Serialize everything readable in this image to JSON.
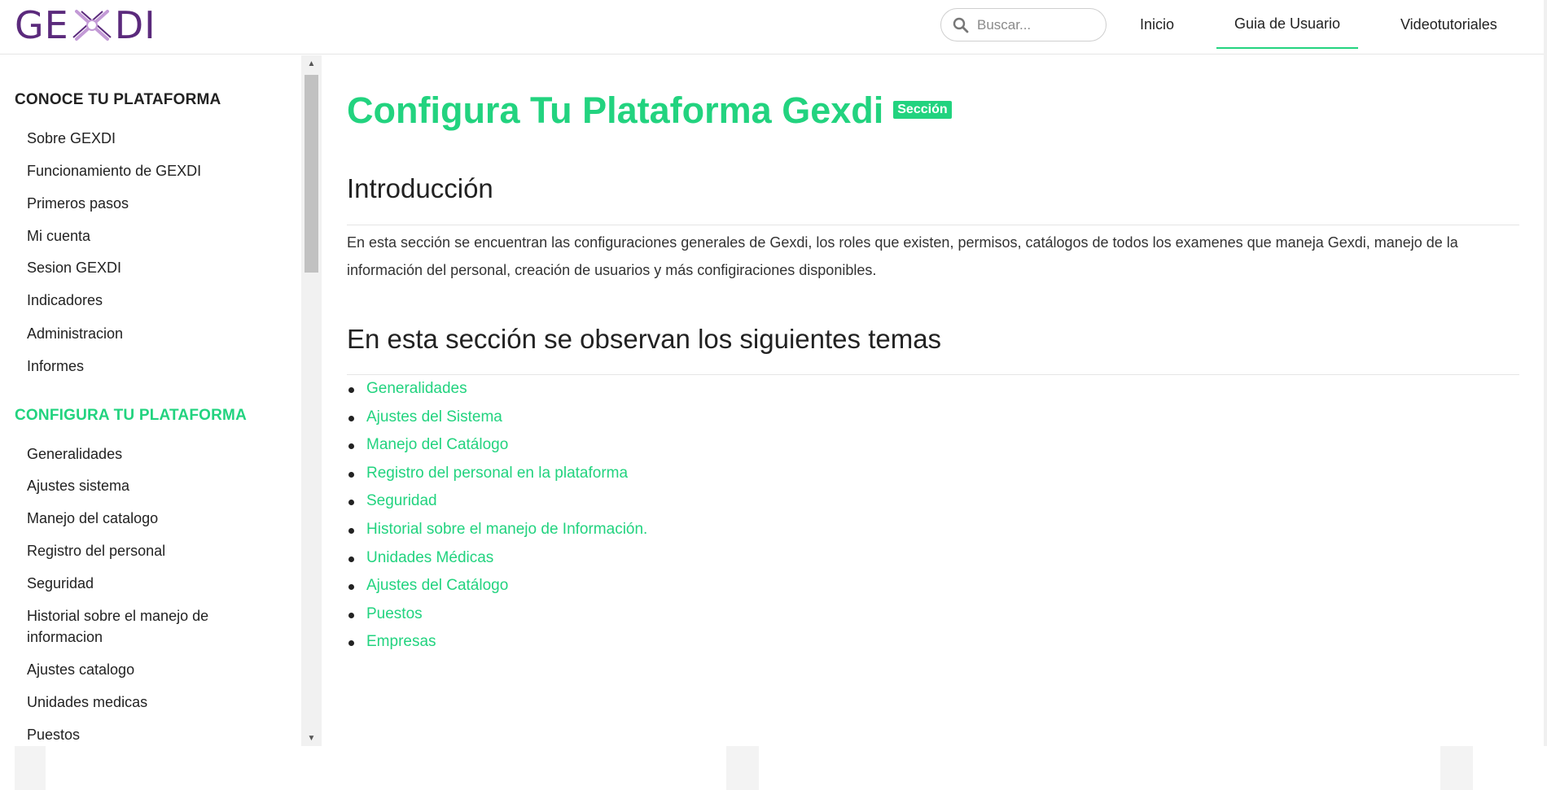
{
  "brand": {
    "logo_left": "GE",
    "logo_right": "DI",
    "logo_color": "#5b2a7c",
    "accent_color": "#22d37f"
  },
  "header": {
    "search": {
      "placeholder": "Buscar...",
      "icon": "search-icon"
    },
    "nav": [
      {
        "label": "Inicio",
        "active": false
      },
      {
        "label": "Guia de Usuario",
        "active": true
      },
      {
        "label": "Videotutoriales",
        "active": false
      }
    ]
  },
  "sidebar": {
    "sections": [
      {
        "title": "CONOCE TU PLATAFORMA",
        "color": "#222222",
        "items": [
          "Sobre GEXDI",
          "Funcionamiento de GEXDI",
          "Primeros pasos",
          "Mi cuenta",
          "Sesion GEXDI",
          "Indicadores",
          "Administracion",
          "Informes"
        ]
      },
      {
        "title": "CONFIGURA TU PLATAFORMA",
        "color": "#22d37f",
        "items": [
          "Generalidades",
          "Ajustes sistema",
          "Manejo del catalogo",
          "Registro del personal",
          "Seguridad",
          "Historial sobre el manejo de informacion",
          "Ajustes catalogo",
          "Unidades medicas",
          "Puestos"
        ]
      }
    ]
  },
  "main": {
    "title": "Configura Tu Plataforma Gexdi",
    "badge": "Sección",
    "intro_heading": "Introducción",
    "intro_text": "En esta sección se encuentran las configuraciones generales de Gexdi, los roles que existen, permisos, catálogos de todos los examenes que maneja Gexdi, manejo de la información del personal, creación de usuarios y más configiraciones disponibles.",
    "topics_heading": "En esta sección se observan los siguientes temas",
    "topics": [
      "Generalidades",
      "Ajustes del Sistema",
      "Manejo del Catálogo",
      "Registro del personal en la plataforma",
      "Seguridad",
      "Historial sobre el manejo de Información.",
      "Unidades Médicas",
      "Ajustes del Catálogo",
      "Puestos",
      "Empresas"
    ]
  }
}
